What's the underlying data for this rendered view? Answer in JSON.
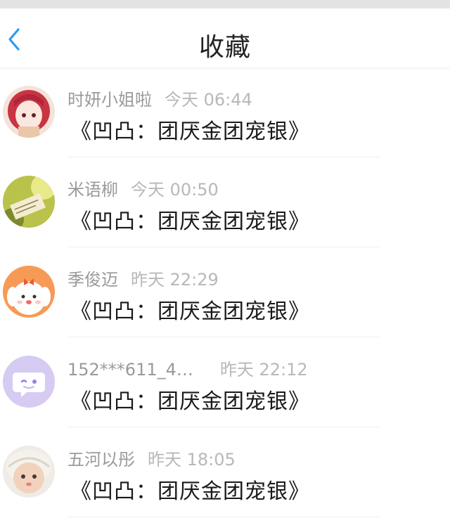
{
  "header": {
    "title": "收藏",
    "back_icon": "chevron-left-icon",
    "accent_color": "#2b9cf2"
  },
  "items": [
    {
      "name": "时妍小姐啦",
      "time": "今天 06:44",
      "content": "《凹凸：团厌金团宠银》"
    },
    {
      "name": "米语柳",
      "time": "今天 00:50",
      "content": "《凹凸：团厌金团宠银》"
    },
    {
      "name": "季俊迈",
      "time": "昨天 22:29",
      "content": "《凹凸：团厌金团宠银》"
    },
    {
      "name": "152***611_4…",
      "time": "昨天 22:12",
      "content": "《凹凸：团厌金团宠银》"
    },
    {
      "name": "五河以彤",
      "time": "昨天 18:05",
      "content": "《凹凸：团厌金团宠银》"
    }
  ]
}
